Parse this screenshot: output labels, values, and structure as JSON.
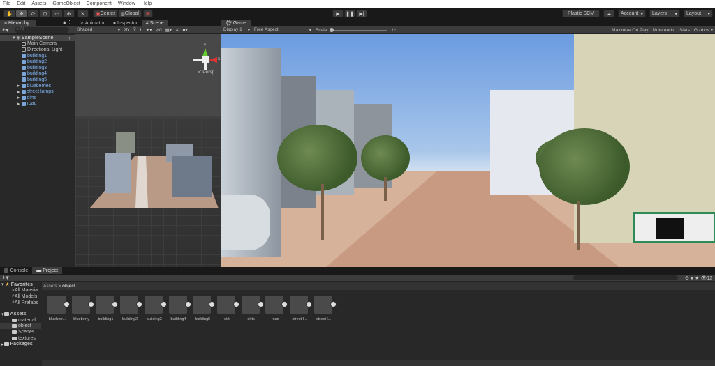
{
  "menu": [
    "File",
    "Edit",
    "Assets",
    "GameObject",
    "Component",
    "Window",
    "Help"
  ],
  "toolbar": {
    "center": "Center",
    "global": "Global",
    "plastic": "Plastic SCM",
    "account": "Account",
    "layers": "Layers",
    "layout": "Layout"
  },
  "hierarchy": {
    "title": "Hierarchy",
    "search_placeholder": "All",
    "scene": "SampleScene",
    "items": [
      {
        "label": "Main Camera",
        "type": "object"
      },
      {
        "label": "Directional Light",
        "type": "object"
      },
      {
        "label": "building1",
        "type": "prefab"
      },
      {
        "label": "building2",
        "type": "prefab"
      },
      {
        "label": "building3",
        "type": "prefab"
      },
      {
        "label": "building4",
        "type": "prefab"
      },
      {
        "label": "building5",
        "type": "prefab"
      },
      {
        "label": "blueberries",
        "type": "prefab",
        "expandable": true
      },
      {
        "label": "street lamps",
        "type": "prefab",
        "expandable": true
      },
      {
        "label": "dirts",
        "type": "prefab",
        "expandable": true
      },
      {
        "label": "road",
        "type": "prefab",
        "expandable": true
      }
    ]
  },
  "scene_tabs": [
    "Animator",
    "Inspector",
    "Scene"
  ],
  "scene": {
    "shading": "Shaded",
    "mode2d": "2D",
    "gizmo_count": "0",
    "persp": "Persp",
    "axis_y": "y",
    "axis_x": "x"
  },
  "game": {
    "tab": "Game",
    "display": "Display 1",
    "aspect": "Free Aspect",
    "scale_label": "Scale",
    "scale_value": "1x",
    "scale_fraction": 0,
    "maximize": "Maximize On Play",
    "mute": "Mute Audio",
    "stats": "Stats",
    "gizmos": "Gizmos"
  },
  "bottom_tabs": [
    "Console",
    "Project"
  ],
  "project": {
    "favorites": "Favorites",
    "fav_items": [
      "All Materia",
      "All Models",
      "All Prefabs"
    ],
    "assets": "Assets",
    "folders": [
      "material",
      "object",
      "Scenes",
      "textures"
    ],
    "packages": "Packages",
    "breadcrumb": [
      "Assets",
      "object"
    ],
    "items": [
      "blueberr...",
      "blueberry",
      "building1",
      "building2",
      "building3",
      "building4",
      "building5",
      "dirt",
      "dirts",
      "road",
      "street l...",
      "street l..."
    ],
    "hidden_count": "12"
  }
}
